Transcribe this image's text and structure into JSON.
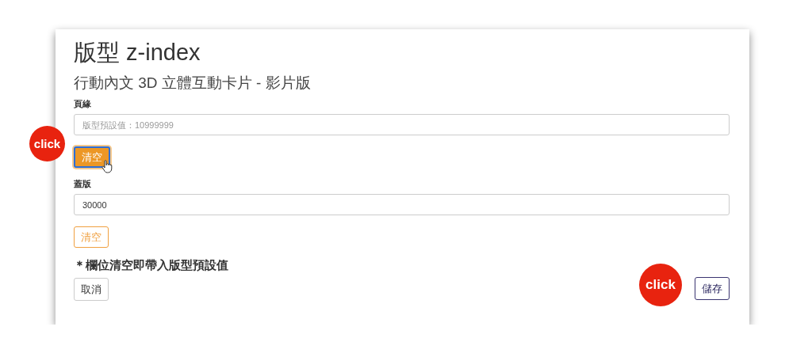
{
  "title": "版型 z-index",
  "subtitle": "行動內文 3D 立體互動卡片 - 影片版",
  "fields": [
    {
      "label": "頁緣",
      "placeholder": "版型預設值：10999999",
      "clear_button": {
        "label": "清空",
        "focused": true
      }
    },
    {
      "label": "蓋版",
      "value": "30000",
      "clear_button": {
        "label": "清空",
        "focused": false
      }
    }
  ],
  "note": "＊欄位清空即帶入版型預設值",
  "cancel_button": "取消",
  "save_button": "儲存",
  "click_badges": [
    "click",
    "click"
  ]
}
